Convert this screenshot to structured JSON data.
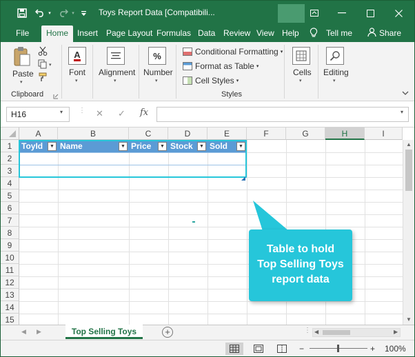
{
  "title_bar": {
    "title": "Toys Report Data  [Compatibili...",
    "qa_save_icon": "save-icon",
    "qa_undo_icon": "undo-icon",
    "qa_redo_icon": "redo-icon",
    "qa_customize_icon": "customize-icon"
  },
  "tabs": [
    "File",
    "Home",
    "Insert",
    "Page Layout",
    "Formulas",
    "Data",
    "Review",
    "View",
    "Help"
  ],
  "active_tab": "Home",
  "tell_me": "Tell me",
  "share": "Share",
  "ribbon": {
    "clipboard": {
      "paste": "Paste",
      "group": "Clipboard"
    },
    "font": "Font",
    "alignment": "Alignment",
    "number": "Number",
    "number_symbol": "%",
    "styles": {
      "conditional": "Conditional Formatting",
      "format_table": "Format as Table",
      "cell_styles": "Cell Styles",
      "group": "Styles"
    },
    "cells": "Cells",
    "editing": "Editing",
    "font_symbol": "A"
  },
  "formula_bar": {
    "name_box": "H16",
    "fx": "fx",
    "cancel": "✕",
    "enter": "✓",
    "formula": ""
  },
  "grid": {
    "columns": [
      "A",
      "B",
      "C",
      "D",
      "E",
      "F",
      "G",
      "H",
      "I"
    ],
    "selected_column": "H",
    "rows": [
      "1",
      "2",
      "3",
      "4",
      "5",
      "6",
      "7",
      "8",
      "9",
      "10",
      "11",
      "12",
      "13",
      "14",
      "15"
    ],
    "table_headers": [
      "ToyId",
      "Name",
      "Price",
      "Stock",
      "Sold"
    ]
  },
  "callout": {
    "line1": "Table to hold",
    "line2": "Top Selling Toys",
    "line3": "report data"
  },
  "sheet_tabs": {
    "active": "Top Selling Toys",
    "add": "+"
  },
  "status_bar": {
    "zoom": "100%",
    "zoom_minus": "−",
    "zoom_plus": "+"
  },
  "colors": {
    "excel_green": "#217346",
    "table_header": "#5b9bd5",
    "callout": "#26c6da"
  }
}
